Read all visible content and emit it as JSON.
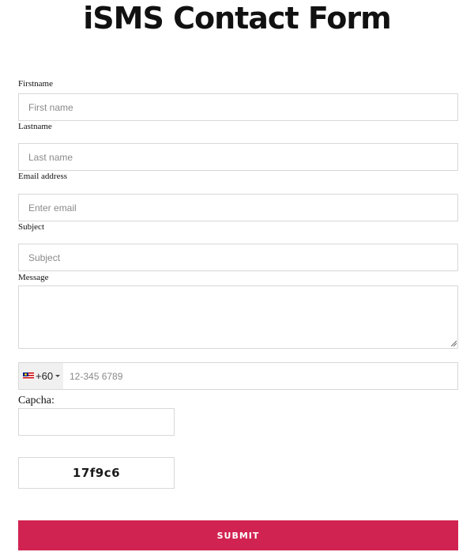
{
  "form": {
    "title": "iSMS Contact Form",
    "firstname": {
      "label": "Firstname",
      "placeholder": "First name",
      "value": ""
    },
    "lastname": {
      "label": "Lastname",
      "placeholder": "Last name",
      "value": ""
    },
    "email": {
      "label": "Email address",
      "placeholder": "Enter email",
      "value": ""
    },
    "subject": {
      "label": "Subject",
      "placeholder": "Subject",
      "value": ""
    },
    "message": {
      "label": "Message",
      "value": ""
    },
    "phone": {
      "country_icon": "malaysia-flag-icon",
      "dial_code": "+60",
      "placeholder": "12-345 6789",
      "value": ""
    },
    "captcha": {
      "label": "Capcha:",
      "value": "",
      "code": "17f9c6"
    },
    "submit_label": "SUBMIT"
  },
  "colors": {
    "submit_bg": "#d12351",
    "submit_text": "#ffffff",
    "border": "#d8d8d8",
    "placeholder": "#8a8a8a"
  }
}
